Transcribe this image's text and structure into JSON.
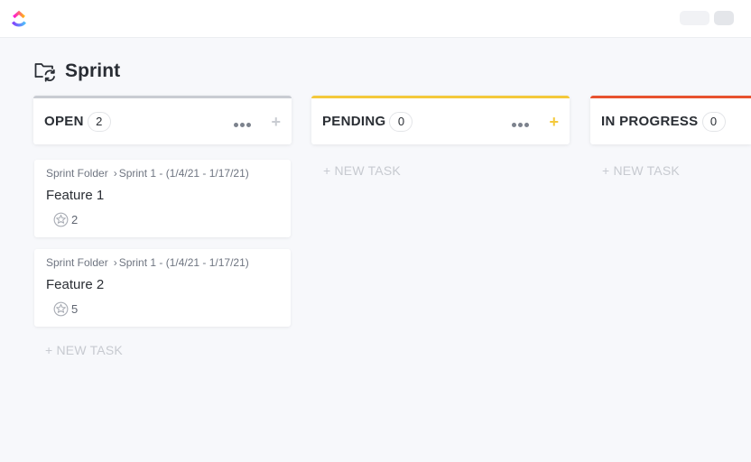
{
  "brand": {
    "logo_icon": "clickup-logo-icon"
  },
  "page": {
    "title": "Sprint",
    "icon": "folder-sync-icon"
  },
  "colors": {
    "open": "#c9ccd2",
    "pending": "#f4c93b",
    "in_progress": "#e8522f"
  },
  "columns": [
    {
      "name": "OPEN",
      "count": "2",
      "new_task": "+ NEW TASK",
      "cards": [
        {
          "folder": "Sprint Folder",
          "list": "Sprint 1 - (1/4/21 - 1/17/21)",
          "title": "Feature 1",
          "points": "2"
        },
        {
          "folder": "Sprint Folder",
          "list": "Sprint 1 - (1/4/21 - 1/17/21)",
          "title": "Feature 2",
          "points": "5"
        }
      ]
    },
    {
      "name": "PENDING",
      "count": "0",
      "new_task": "+ NEW TASK",
      "cards": []
    },
    {
      "name": "IN PROGRESS",
      "count": "0",
      "new_task": "+ NEW TASK",
      "cards": []
    }
  ]
}
